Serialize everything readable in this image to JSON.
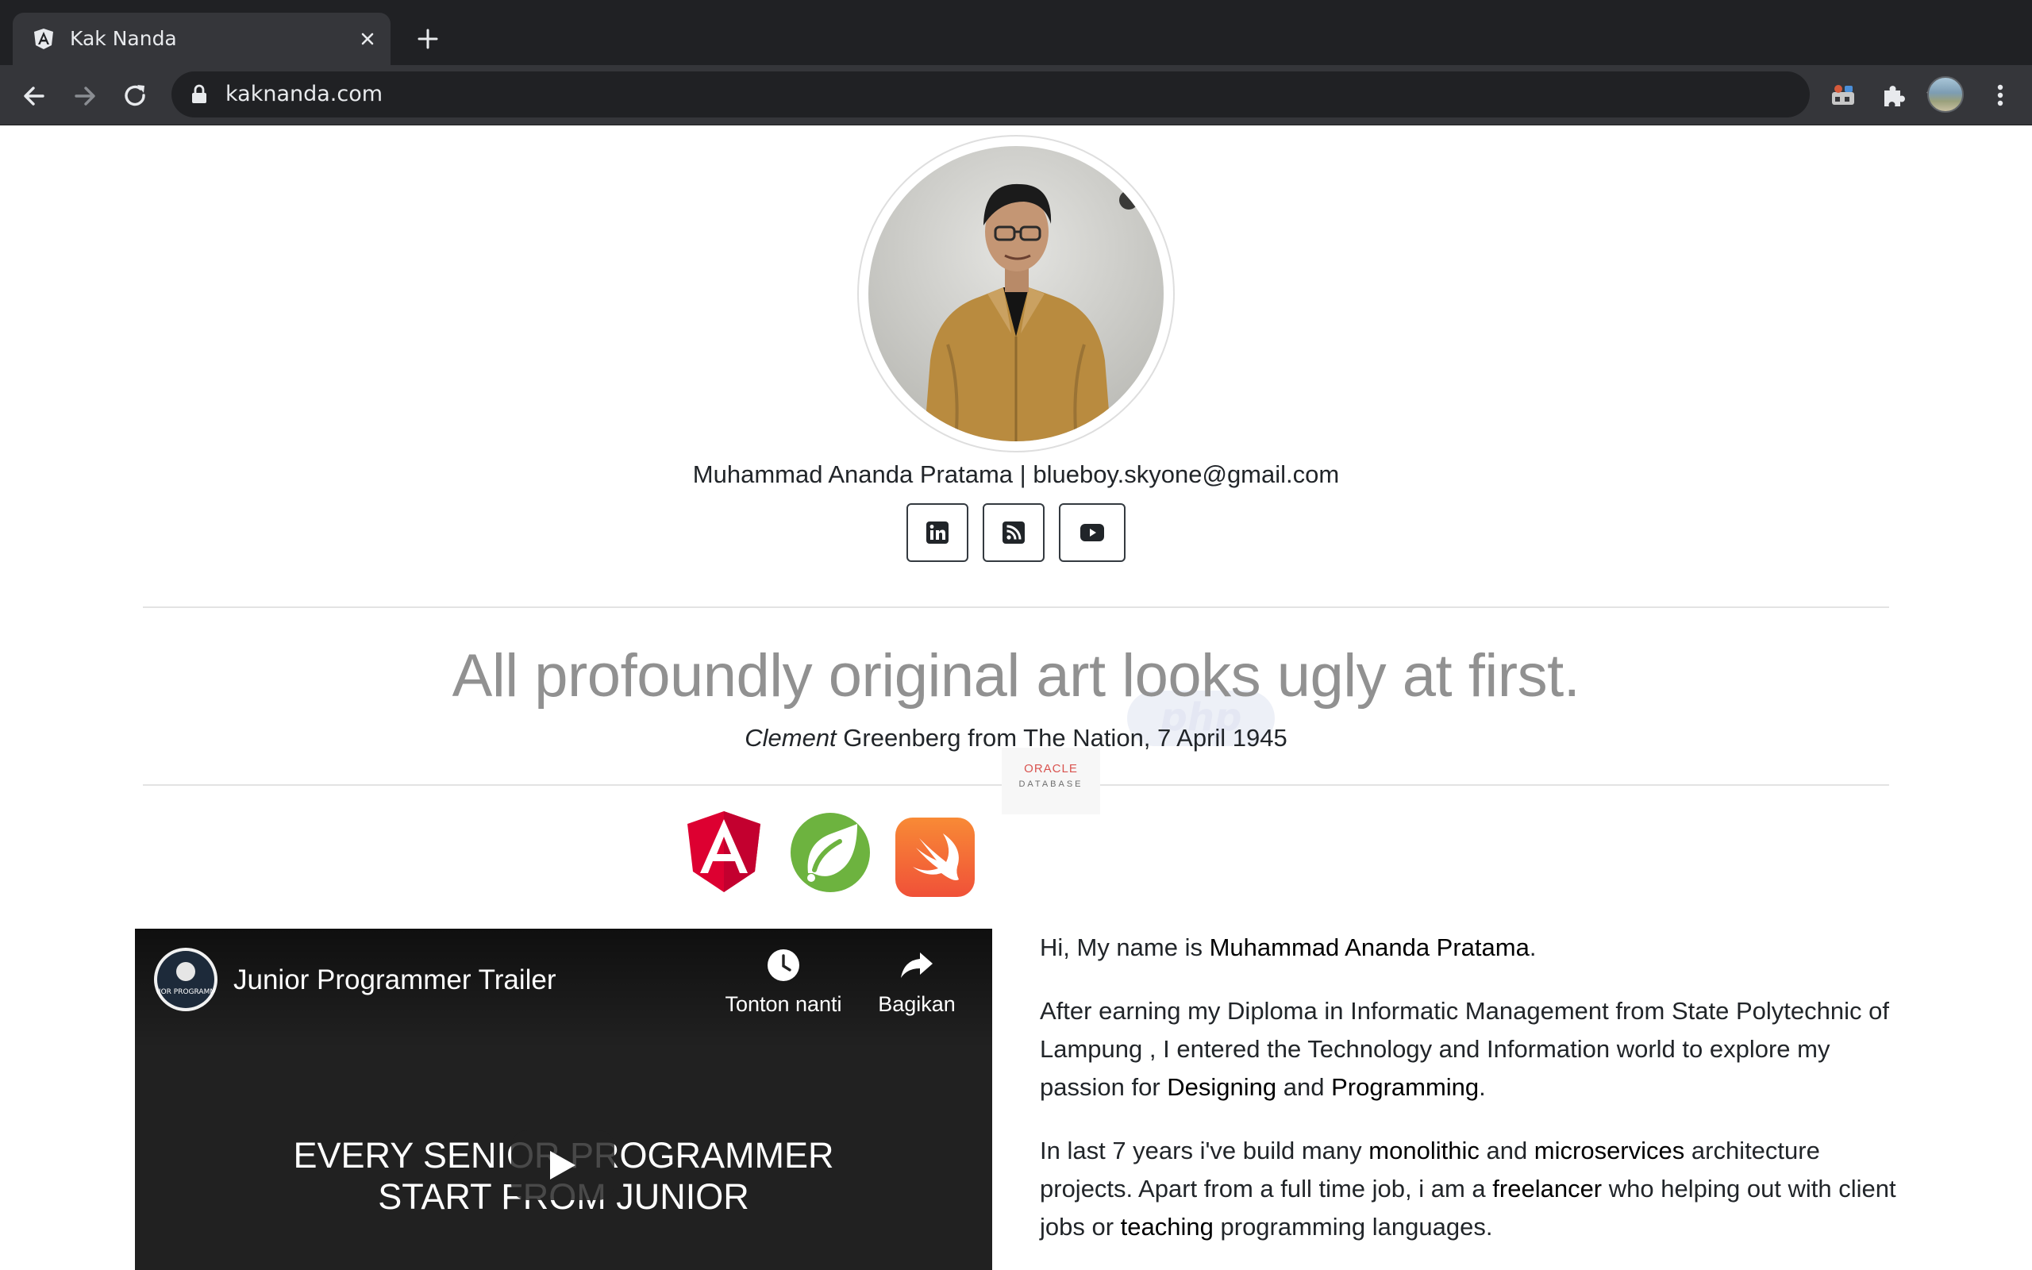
{
  "browser": {
    "tab_title": "Kak Nanda",
    "url": "kaknanda.com",
    "tab_favicon": "angular-icon",
    "colors": {
      "tabstrip": "#202124",
      "toolbar": "#35363a",
      "omnibox": "#202124"
    }
  },
  "profile": {
    "name": "Muhammad Ananda Pratama",
    "separator": "|",
    "email": "blueboy.skyone@gmail.com",
    "social": [
      "linkedin-icon",
      "rss-icon",
      "youtube-icon"
    ]
  },
  "quote": {
    "text": "All profoundly original art looks ugly at first.",
    "source_first": "Clement",
    "source_rest": "Greenberg from The Nation, 7 April 1945"
  },
  "tech_logos": {
    "php": "php",
    "oracle_name": "ORACLE",
    "oracle_product": "DATABASE",
    "icons": [
      "angular-icon",
      "spring-icon",
      "swift-icon"
    ]
  },
  "video": {
    "channel": "JUNIOR PROGRAMMER",
    "title": "Junior Programmer Trailer",
    "watch_later": "Tonton nanti",
    "share": "Bagikan",
    "banner_line1": "EVERY SENIOR PROGRAMMER",
    "banner_line2": "START FROM JUNIOR"
  },
  "bio": {
    "p1_a": "Hi, My name is ",
    "p1_name": "Muhammad Ananda Pratama",
    "p1_b": ".",
    "p2_a": "After earning my Diploma in Informatic Management from State Polytechnic of Lampung , I entered the Technology and Information world to explore my passion for ",
    "p2_designing": "Designing",
    "p2_and": " and ",
    "p2_programming": "Programming",
    "p2_end": ".",
    "p3_a": "In last 7 years i've build many ",
    "p3_monolithic": "monolithic",
    "p3_and": " and ",
    "p3_microservices": "microservices",
    "p3_b": " architecture projects. Apart from a full time job, i am a ",
    "p3_freelancer": "freelancer",
    "p3_c": " who helping out with client jobs or ",
    "p3_teaching": "teaching",
    "p3_d": " programming languages."
  }
}
